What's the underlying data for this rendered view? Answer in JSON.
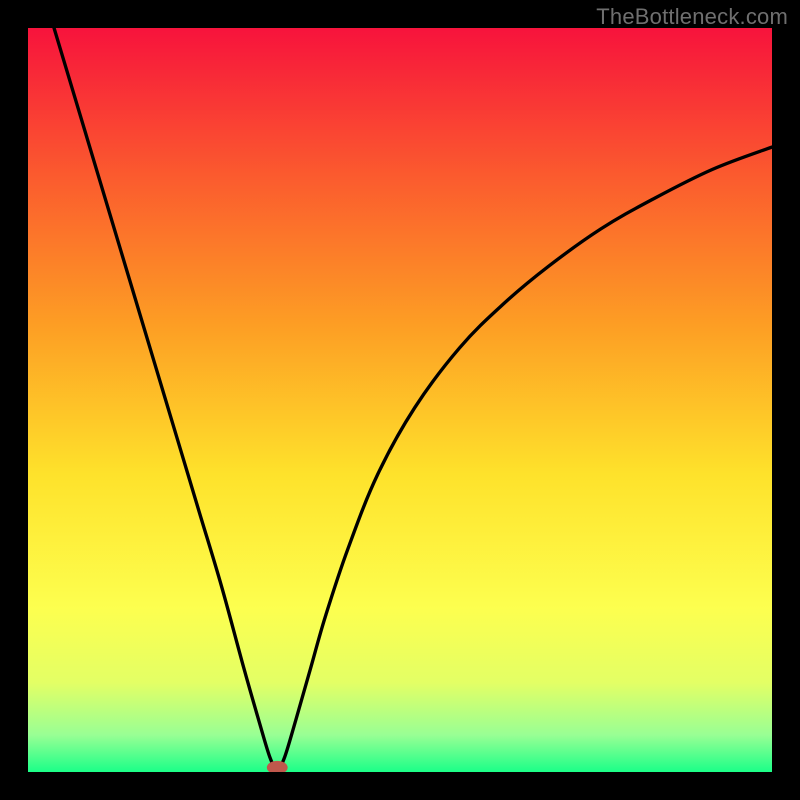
{
  "watermark": "TheBottleneck.com",
  "chart_data": {
    "type": "line",
    "title": "",
    "xlabel": "",
    "ylabel": "",
    "xlim": [
      0,
      100
    ],
    "ylim": [
      0,
      100
    ],
    "legend": false,
    "grid": false,
    "background_gradient": {
      "stops": [
        {
          "offset": 0.0,
          "color": "#f7133c"
        },
        {
          "offset": 0.2,
          "color": "#fb5b2e"
        },
        {
          "offset": 0.4,
          "color": "#fd9e24"
        },
        {
          "offset": 0.6,
          "color": "#fee22b"
        },
        {
          "offset": 0.78,
          "color": "#fdff4f"
        },
        {
          "offset": 0.88,
          "color": "#e3ff65"
        },
        {
          "offset": 0.95,
          "color": "#99ff94"
        },
        {
          "offset": 1.0,
          "color": "#1bff88"
        }
      ]
    },
    "series": [
      {
        "name": "left-branch",
        "type": "line",
        "color": "#000000",
        "x": [
          3.5,
          5,
          8,
          11,
          14,
          17,
          20,
          23,
          26,
          29,
          31,
          32.5,
          33.5
        ],
        "y": [
          100,
          95,
          85,
          75,
          65,
          55,
          45,
          35,
          25,
          14,
          7,
          2,
          0
        ]
      },
      {
        "name": "right-branch",
        "type": "line",
        "color": "#000000",
        "x": [
          33.5,
          34.5,
          36,
          38,
          40,
          43,
          47,
          52,
          58,
          64,
          70,
          77,
          84,
          92,
          100
        ],
        "y": [
          0,
          2,
          7,
          14,
          21,
          30,
          40,
          49,
          57,
          63,
          68,
          73,
          77,
          81,
          84
        ]
      }
    ],
    "marker": {
      "name": "bottleneck-marker",
      "x": 33.5,
      "y": 0.6,
      "rx": 1.4,
      "ry": 0.9,
      "color": "#c0584c"
    }
  }
}
